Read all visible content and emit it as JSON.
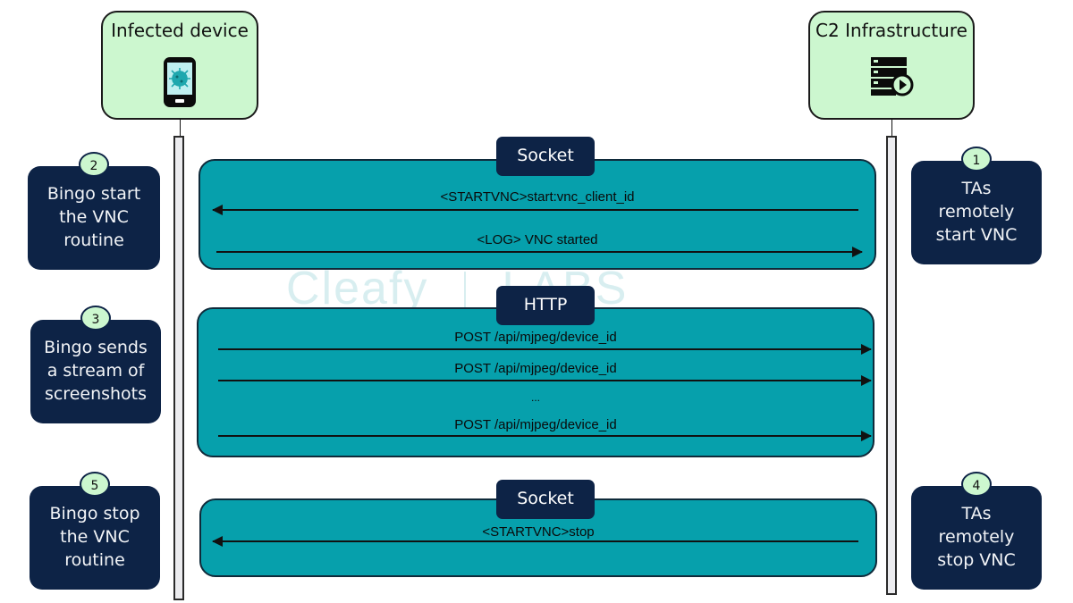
{
  "actors": {
    "device": {
      "title": "Infected device",
      "icon": "infected-phone-icon"
    },
    "c2": {
      "title": "C2 Infrastructure",
      "icon": "server-play-icon"
    }
  },
  "watermark": {
    "left": "Cleafy",
    "right": "LABS"
  },
  "steps": [
    {
      "number": "1",
      "side": "right",
      "text": [
        "TAs",
        "remotely",
        "start VNC"
      ]
    },
    {
      "number": "2",
      "side": "left",
      "text": [
        "Bingo start",
        "the VNC",
        "routine"
      ]
    },
    {
      "number": "3",
      "side": "left",
      "text": [
        "Bingo sends",
        "a stream of",
        "screenshots"
      ]
    },
    {
      "number": "4",
      "side": "right",
      "text": [
        "TAs",
        "remotely",
        "stop VNC"
      ]
    },
    {
      "number": "5",
      "side": "left",
      "text": [
        "Bingo stop",
        "the VNC",
        "routine"
      ]
    }
  ],
  "phases": [
    {
      "protocol": "Socket",
      "messages": [
        {
          "label": "<STARTVNC>start:vnc_client_id",
          "direction": "c2-to-device"
        },
        {
          "label": "<LOG> VNC started",
          "direction": "device-to-c2"
        }
      ]
    },
    {
      "protocol": "HTTP",
      "messages": [
        {
          "label": "POST /api/mjpeg/device_id",
          "direction": "device-to-c2"
        },
        {
          "label": "POST /api/mjpeg/device_id",
          "direction": "device-to-c2"
        },
        {
          "label": "...",
          "direction": "none"
        },
        {
          "label": "POST /api/mjpeg/device_id",
          "direction": "device-to-c2"
        }
      ]
    },
    {
      "protocol": "Socket",
      "messages": [
        {
          "label": "<STARTVNC>stop",
          "direction": "c2-to-device"
        }
      ]
    }
  ],
  "colors": {
    "actor_fill": "#ccf7cf",
    "note_fill": "#0d2346",
    "band_fill": "#06a0ac",
    "lifeline_fill": "#ececef"
  }
}
